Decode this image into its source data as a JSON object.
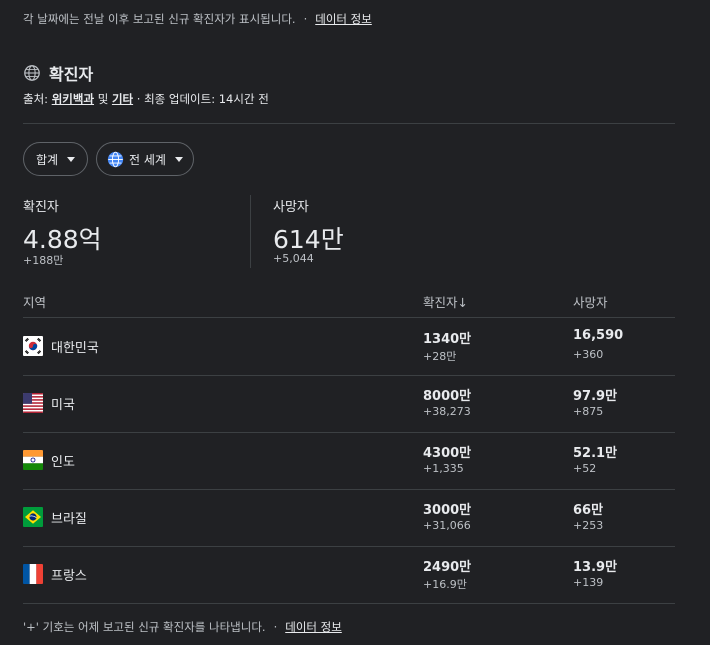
{
  "top_note": {
    "text": "각 날짜에는 전날 이후 보고된 신규 확진자가 표시됩니다.",
    "separator": "·",
    "link": "데이터 정보"
  },
  "header": {
    "title": "확진자",
    "source_prefix": "출처:",
    "source_link_1": "위키백과",
    "source_and": "및",
    "source_link_2": "기타",
    "updated": "· 최종 업데이트: 14시간 전"
  },
  "filters": {
    "total": "합계",
    "region": "전 세계"
  },
  "summary": {
    "cases": {
      "label": "확진자",
      "value": "4.88억",
      "delta": "+188만"
    },
    "deaths": {
      "label": "사망자",
      "value": "614만",
      "delta": "+5,044"
    }
  },
  "table": {
    "headers": {
      "region": "지역",
      "cases": "확진자↓",
      "deaths": "사망자"
    },
    "rows": [
      {
        "country": "대한민국",
        "flag": "kr",
        "cases": "1340만",
        "cases_delta": "+28만",
        "deaths": "16,590",
        "deaths_delta": "+360"
      },
      {
        "country": "미국",
        "flag": "us",
        "cases": "8000만",
        "cases_delta": "+38,273",
        "deaths": "97.9만",
        "deaths_delta": "+875"
      },
      {
        "country": "인도",
        "flag": "in",
        "cases": "4300만",
        "cases_delta": "+1,335",
        "deaths": "52.1만",
        "deaths_delta": "+52"
      },
      {
        "country": "브라질",
        "flag": "br",
        "cases": "3000만",
        "cases_delta": "+31,066",
        "deaths": "66만",
        "deaths_delta": "+253"
      },
      {
        "country": "프랑스",
        "flag": "fr",
        "cases": "2490만",
        "cases_delta": "+16.9만",
        "deaths": "13.9만",
        "deaths_delta": "+139"
      }
    ]
  },
  "bottom_note": {
    "text": "'+' 기호는 어제 보고된 신규 확진자를 나타냅니다.",
    "separator": "·",
    "link": "데이터 정보"
  },
  "colors": {
    "background": "#202124",
    "text": "#e8eaed",
    "muted": "#bdc1c6",
    "divider": "#3c4043",
    "globe_blue": "#4285f4"
  }
}
